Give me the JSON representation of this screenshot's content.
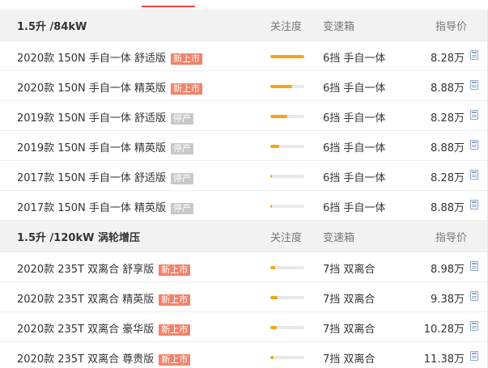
{
  "groups": [
    {
      "title": "1.5升 /84kW",
      "columns": {
        "attention": "关注度",
        "transmission": "变速箱",
        "price": "指导价"
      },
      "rows": [
        {
          "name": "2020款 150N 手自一体 舒适版",
          "badge": "新上市",
          "badge_type": "new",
          "attention": 1.0,
          "transmission": "6挡 手自一体",
          "price": "8.28万"
        },
        {
          "name": "2020款 150N 手自一体 精英版",
          "badge": "新上市",
          "badge_type": "new",
          "attention": 0.65,
          "transmission": "6挡 手自一体",
          "price": "8.88万"
        },
        {
          "name": "2019款 150N 手自一体 舒适版",
          "badge": "停产",
          "badge_type": "stop",
          "attention": 0.5,
          "transmission": "6挡 手自一体",
          "price": "8.28万"
        },
        {
          "name": "2019款 150N 手自一体 精英版",
          "badge": "停产",
          "badge_type": "stop",
          "attention": 0.25,
          "transmission": "6挡 手自一体",
          "price": "8.88万"
        },
        {
          "name": "2017款 150N 手自一体 舒适版",
          "badge": "停产",
          "badge_type": "stop",
          "attention": 0.04,
          "transmission": "6挡 手自一体",
          "price": "8.28万"
        },
        {
          "name": "2017款 150N 手自一体 精英版",
          "badge": "停产",
          "badge_type": "stop",
          "attention": 0.04,
          "transmission": "6挡 手自一体",
          "price": "8.88万"
        }
      ]
    },
    {
      "title": "1.5升 /120kW 涡轮增压",
      "columns": {
        "attention": "关注度",
        "transmission": "变速箱",
        "price": "指导价"
      },
      "rows": [
        {
          "name": "2020款 235T 双离合 舒享版",
          "badge": "新上市",
          "badge_type": "new",
          "attention": 0.15,
          "transmission": "7挡 双离合",
          "price": "8.98万"
        },
        {
          "name": "2020款 235T 双离合 精英版",
          "badge": "新上市",
          "badge_type": "new",
          "attention": 0.22,
          "transmission": "7挡 双离合",
          "price": "9.38万"
        },
        {
          "name": "2020款 235T 双离合 豪华版",
          "badge": "新上市",
          "badge_type": "new",
          "attention": 0.2,
          "transmission": "7挡 双离合",
          "price": "10.28万"
        },
        {
          "name": "2020款 235T 双离合 尊贵版",
          "badge": "新上市",
          "badge_type": "new",
          "attention": 0.1,
          "transmission": "7挡 双离合",
          "price": "11.38万"
        }
      ]
    }
  ],
  "colors": {
    "accent": "#e64545",
    "badge_new": "#f0836b",
    "badge_stop": "#c8c8c8",
    "bar_fill": "#f5a414",
    "bar_track": "#e8e8e8",
    "header_bg": "#f2f2f2"
  },
  "icons": {
    "price_action": "calculator-icon"
  }
}
